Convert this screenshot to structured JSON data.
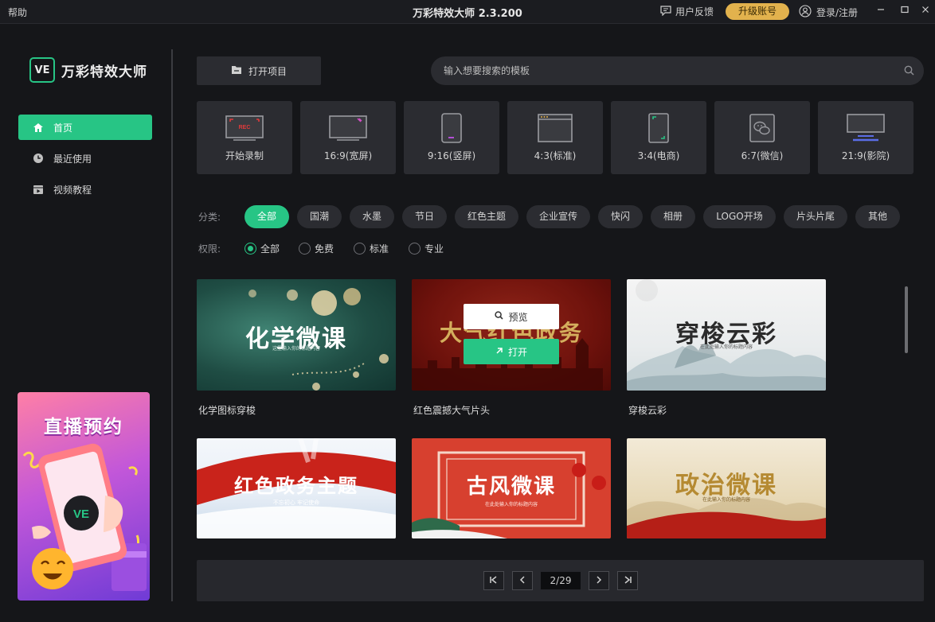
{
  "titlebar": {
    "help": "帮助",
    "title": "万彩特效大师 2.3.200",
    "feedback": "用户反馈",
    "upgrade": "升级账号",
    "login": "登录/注册"
  },
  "sidebar": {
    "logo_badge": "VE",
    "logo_text": "万彩特效大师",
    "items": [
      {
        "label": "首页",
        "icon": "home-icon"
      },
      {
        "label": "最近使用",
        "icon": "clock-icon"
      },
      {
        "label": "视频教程",
        "icon": "video-icon"
      }
    ],
    "promo_title": "直播预约",
    "promo_badge": "VE"
  },
  "toolbar": {
    "open_project": "打开项目",
    "search_placeholder": "输入想要搜索的模板"
  },
  "ratios": [
    {
      "label": "开始录制",
      "icon": "record-icon",
      "badge": "REC"
    },
    {
      "label": "16:9(宽屏)",
      "icon": "widescreen-icon"
    },
    {
      "label": "9:16(竖屏)",
      "icon": "portrait-icon"
    },
    {
      "label": "4:3(标准)",
      "icon": "standard-icon"
    },
    {
      "label": "3:4(电商)",
      "icon": "ecommerce-icon"
    },
    {
      "label": "6:7(微信)",
      "icon": "wechat-icon"
    },
    {
      "label": "21:9(影院)",
      "icon": "cinema-icon"
    }
  ],
  "filters": {
    "category_label": "分类:",
    "categories": [
      "全部",
      "国潮",
      "水墨",
      "节日",
      "红色主题",
      "企业宣传",
      "快闪",
      "相册",
      "LOGO开场",
      "片头片尾",
      "其他"
    ],
    "active_category": "全部",
    "permission_label": "权限:",
    "permissions": [
      "全部",
      "免费",
      "标准",
      "专业"
    ],
    "active_permission": "全部"
  },
  "templates": [
    {
      "caption": "化学图标穿梭",
      "thumb_text": "化学微课",
      "thumb_sub": "这里输入你的标题内容"
    },
    {
      "caption": "红色震撼大气片头",
      "thumb_text": "大气红色政务",
      "thumb_sub": "",
      "preview": "预览",
      "open": "打开"
    },
    {
      "caption": "穿梭云彩",
      "thumb_text": "穿梭云彩",
      "thumb_sub": "在此处输入你的标题内容"
    },
    {
      "caption": "",
      "thumb_text": "红色政务主题",
      "thumb_sub": "不忘初心 牢记使命"
    },
    {
      "caption": "",
      "thumb_text": "古风微课",
      "thumb_sub": "在此处输入你的标题内容"
    },
    {
      "caption": "",
      "thumb_text": "政治微课",
      "thumb_sub": "在此输入你的标题内容"
    }
  ],
  "pager": {
    "indicator": "2/29"
  },
  "colors": {
    "accent": "#27c585",
    "gold": "#e2b24d",
    "panel": "#2b2c31",
    "bg": "#151619"
  }
}
